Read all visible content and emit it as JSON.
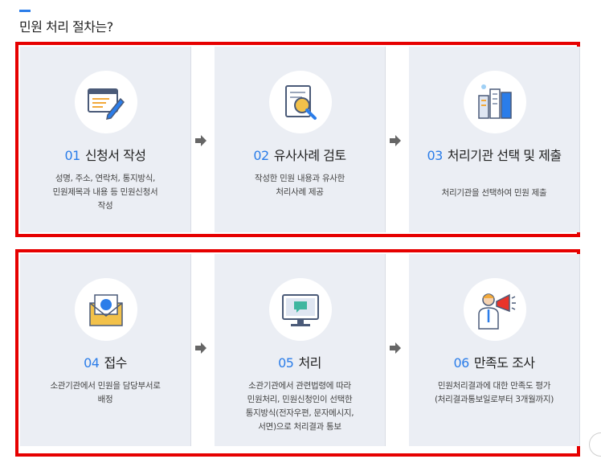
{
  "page": {
    "title": "민원 처리 절차는?"
  },
  "steps": [
    {
      "num": "01",
      "title": "신청서 작성",
      "desc": [
        "성명, 주소, 연락처, 통지방식,",
        "민원제목과 내용 등 민원신청서",
        "작성"
      ],
      "icon": "form-pen-icon"
    },
    {
      "num": "02",
      "title": "유사사례 검토",
      "desc": [
        "작성한 민원 내용과 유사한",
        "처리사례 제공"
      ],
      "icon": "document-magnifier-icon"
    },
    {
      "num": "03",
      "title": "처리기관 선택 및 제출",
      "desc": [
        "처리기관을 선택하여 민원 제출"
      ],
      "icon": "buildings-icon"
    },
    {
      "num": "04",
      "title": "접수",
      "desc": [
        "소관기관에서 민원을 담당부서로",
        "배정"
      ],
      "icon": "envelope-icon"
    },
    {
      "num": "05",
      "title": "처리",
      "desc": [
        "소관기관에서 관련법령에 따라",
        "민원처리, 민원신청인이 선택한",
        "통지방식(전자우편, 문자메시지,",
        "서면)으로 처리결과 통보"
      ],
      "icon": "monitor-chat-icon"
    },
    {
      "num": "06",
      "title": "만족도 조사",
      "desc": [
        "민원처리결과에 대한 만족도 평가",
        "(처리결과통보일로부터 3개월까지)"
      ],
      "icon": "megaphone-person-icon"
    }
  ],
  "colors": {
    "accent": "#2b7de9",
    "highlight_border": "#e60000",
    "card_bg": "#ebeef4"
  }
}
